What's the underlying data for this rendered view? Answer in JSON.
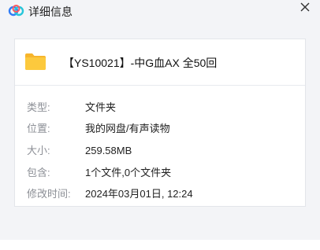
{
  "window": {
    "title": "详细信息",
    "logo_icon": "baidu-netdisk-cloud-icon",
    "close_icon": "close-icon"
  },
  "file": {
    "name": "【YS10021】-中G血AX 全50回",
    "icon": "folder-icon",
    "icon_color": "#f9c33b"
  },
  "details": [
    {
      "label": "类型:",
      "value": "文件夹"
    },
    {
      "label": "位置:",
      "value": "我的网盘/有声读物"
    },
    {
      "label": "大小:",
      "value": "259.58MB"
    },
    {
      "label": "包含:",
      "value": "1个文件,0个文件夹"
    },
    {
      "label": "修改时间:",
      "value": "2024年03月01日, 12:24"
    }
  ],
  "colors": {
    "background": "#f3f4f7",
    "card": "#ffffff",
    "label": "#8c8f96",
    "value": "#222222"
  }
}
